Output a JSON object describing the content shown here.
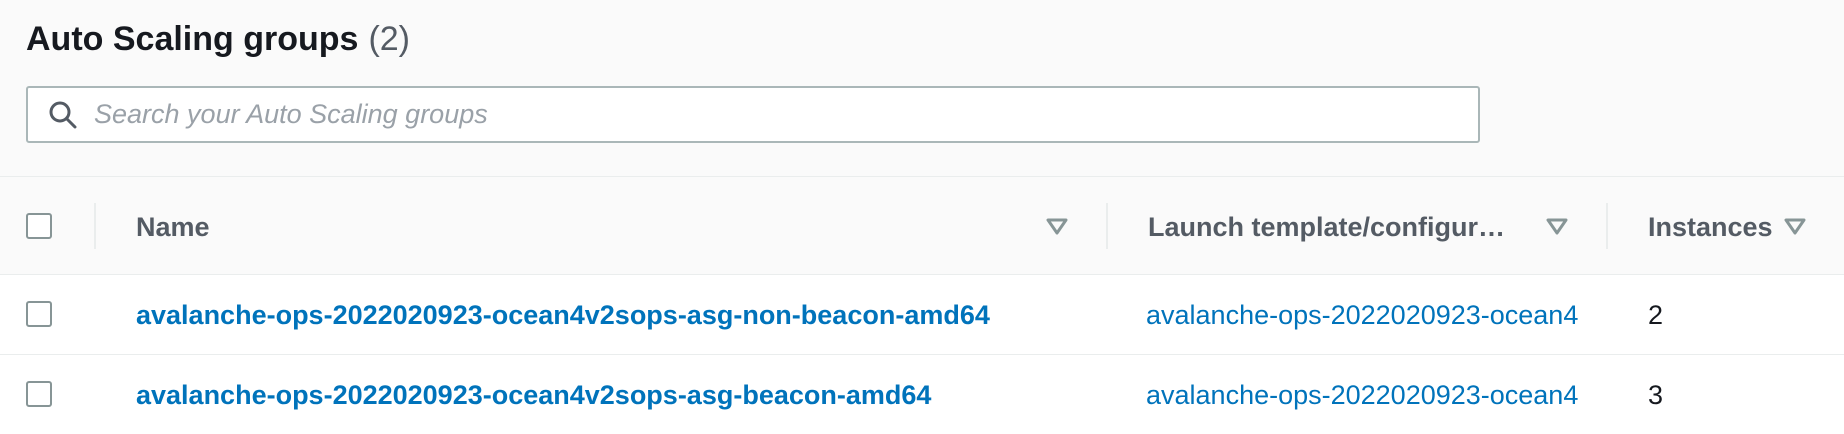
{
  "header": {
    "title": "Auto Scaling groups",
    "count": "(2)"
  },
  "search": {
    "placeholder": "Search your Auto Scaling groups",
    "value": "",
    "icon": "search-icon"
  },
  "table": {
    "columns": [
      {
        "label": "Name",
        "icon": "sort-caret-down-icon"
      },
      {
        "label": "Launch template/configur…",
        "icon": "sort-caret-down-icon"
      },
      {
        "label": "Instances",
        "icon": "sort-caret-down-icon"
      }
    ],
    "rows": [
      {
        "name": "avalanche-ops-2022020923-ocean4v2sops-asg-non-beacon-amd64",
        "launch_template": "avalanche-ops-2022020923-ocean4",
        "instances": "2"
      },
      {
        "name": "avalanche-ops-2022020923-ocean4v2sops-asg-beacon-amd64",
        "launch_template": "avalanche-ops-2022020923-ocean4",
        "instances": "3"
      }
    ]
  },
  "colors": {
    "link": "#0073bb",
    "header_text": "#545b64",
    "border": "#aab7b8",
    "background": "#fafafa"
  }
}
